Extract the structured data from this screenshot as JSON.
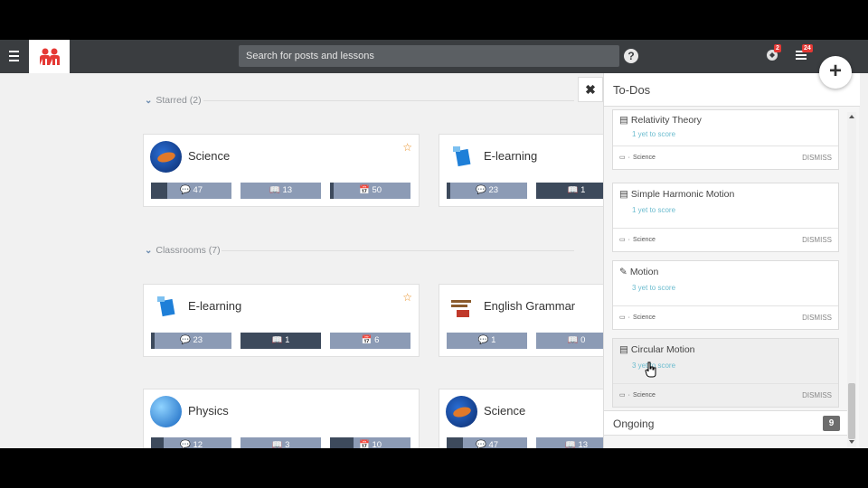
{
  "topbar": {
    "search_placeholder": "Search for posts and lessons",
    "help_label": "?",
    "notifications_count": "2",
    "todos_count": "24"
  },
  "sections": {
    "starred": "Starred (2)",
    "classrooms": "Classrooms (7)"
  },
  "starred_cards": [
    {
      "title": "Science",
      "posts": "47",
      "lessons": "13",
      "events": "50"
    },
    {
      "title": "E-learning",
      "posts": "23",
      "lessons": "1"
    }
  ],
  "classroom_cards": [
    {
      "title": "E-learning",
      "posts": "23",
      "lessons": "1",
      "events": "6"
    },
    {
      "title": "English Grammar",
      "posts": "1",
      "lessons": "0"
    },
    {
      "title": "Physics",
      "posts": "12",
      "lessons": "3",
      "events": "10"
    },
    {
      "title": "Science",
      "posts": "47",
      "lessons": "13"
    }
  ],
  "todo": {
    "title": "To-Dos",
    "items": [
      {
        "title": "Relativity Theory",
        "sub": "1 yet to score",
        "class": "Science",
        "dismiss": "DISMISS"
      },
      {
        "title": "Simple Harmonic Motion",
        "sub": "1 yet to score",
        "class": "Science",
        "dismiss": "DISMISS"
      },
      {
        "title": "Motion",
        "sub": "3 yet to score",
        "class": "Science",
        "dismiss": "DISMISS"
      },
      {
        "title": "Circular Motion",
        "sub": "3 yet to score",
        "class": "Science",
        "dismiss": "DISMISS"
      }
    ],
    "ongoing_label": "Ongoing",
    "ongoing_count": "9"
  },
  "colors": {
    "topbar": "#3a3d40",
    "stat_light": "#8c9bb5",
    "stat_dark": "#3d4a5c",
    "accent_star": "#e88a1a",
    "todo_link": "#6cbccf"
  },
  "icons": {
    "menu": "hamburger-icon",
    "logo": "logo-icon",
    "help": "help-icon",
    "notifications": "notification-icon",
    "todos": "list-icon",
    "add": "plus-icon",
    "close": "close-icon"
  }
}
